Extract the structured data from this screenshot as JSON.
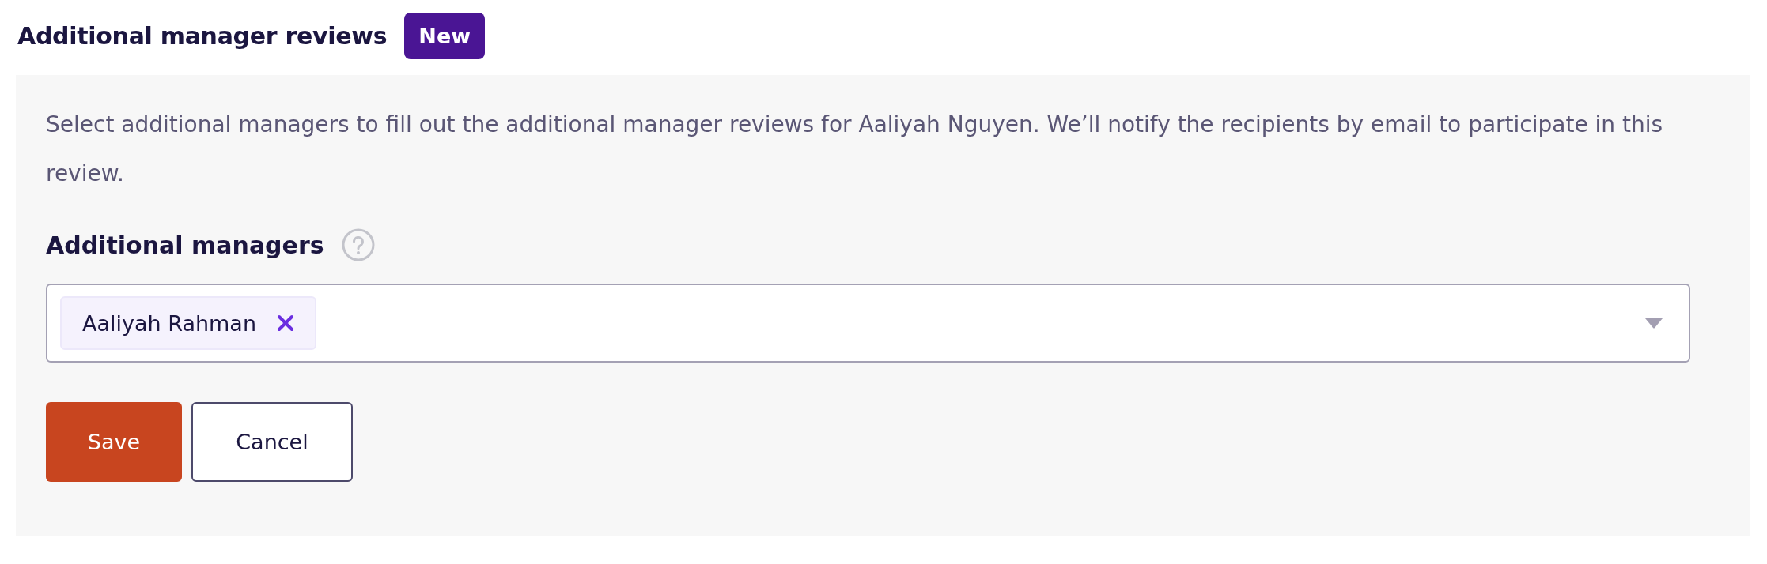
{
  "header": {
    "title": "Additional manager reviews",
    "badge": "New"
  },
  "description": "Select additional managers to fill out the additional manager reviews for Aaliyah Nguyen. We’ll notify the recipients by email to participate in this review.",
  "field": {
    "label": "Additional managers",
    "chips": [
      {
        "label": "Aaliyah Rahman"
      }
    ]
  },
  "buttons": [
    {
      "label": "Save",
      "kind": "primary"
    },
    {
      "label": "Cancel",
      "kind": "secondary"
    }
  ]
}
